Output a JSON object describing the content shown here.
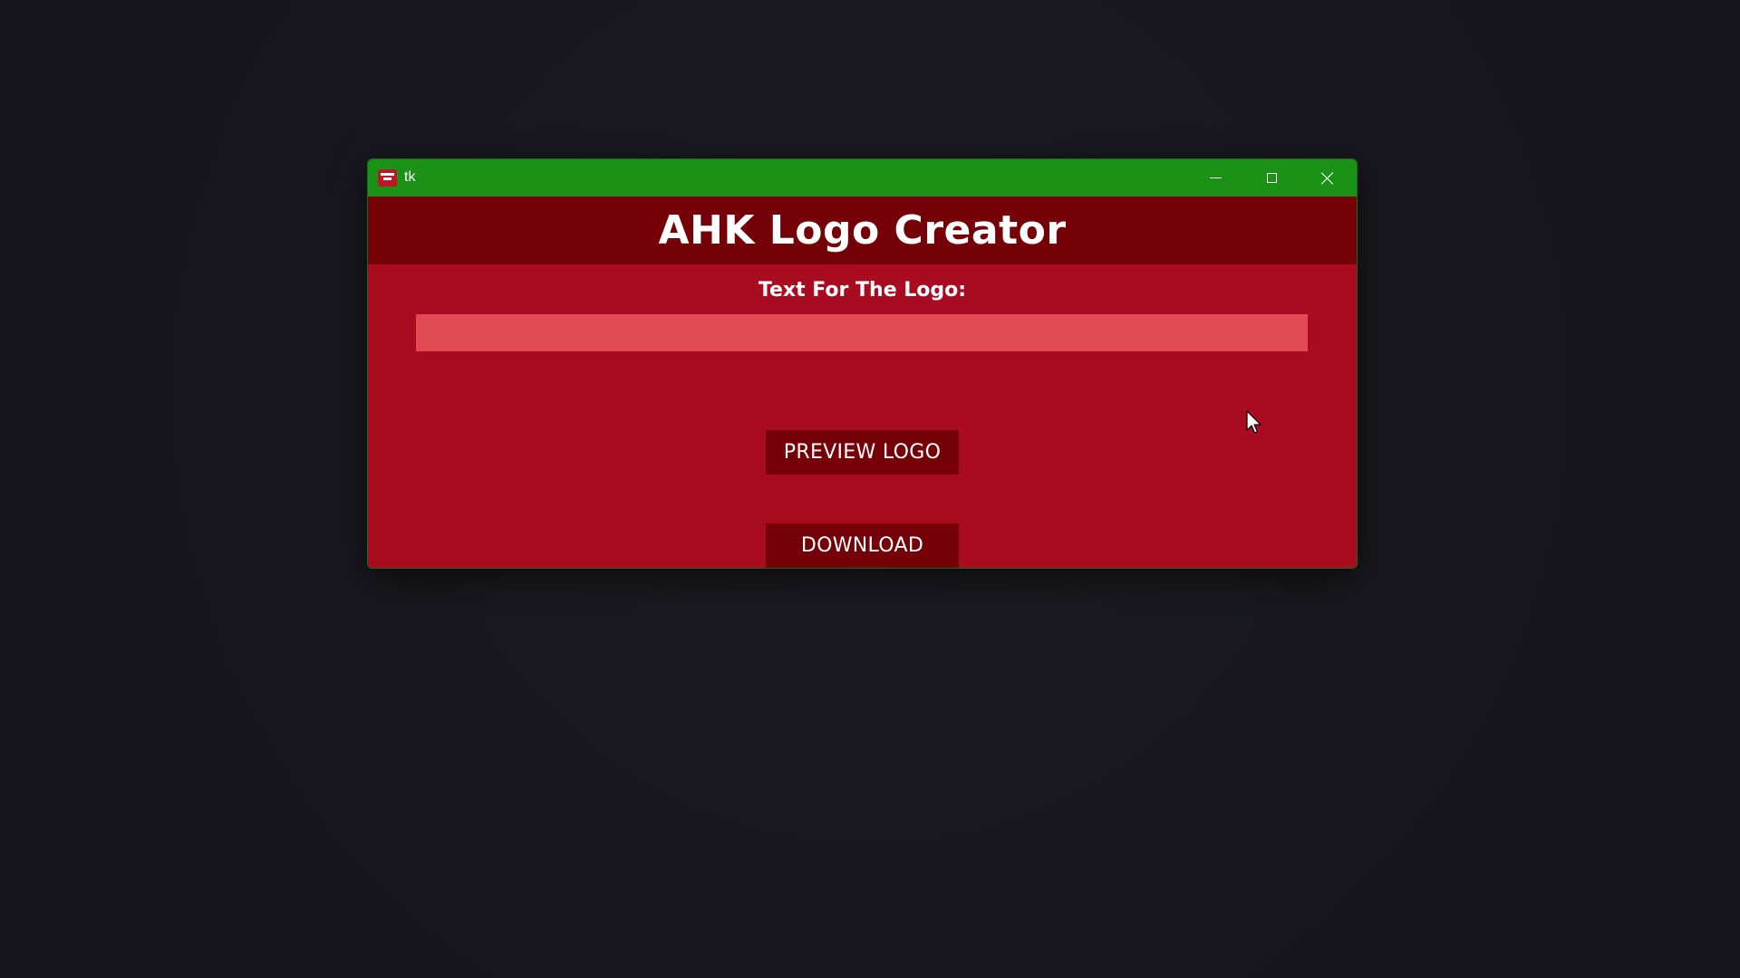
{
  "window": {
    "title": "tk",
    "icon": "app-icon",
    "controls": {
      "minimize_icon": "minimize-icon",
      "maximize_icon": "maximize-icon",
      "close_icon": "close-icon"
    }
  },
  "app": {
    "heading": "AHK Logo Creator",
    "field_label": "Text For The Logo:",
    "input_value": "",
    "preview_button": "PREVIEW LOGO",
    "download_button": "DOWNLOAD"
  },
  "colors": {
    "titlebar": "#1b9216",
    "header_band": "#760007",
    "body": "#a90b20",
    "input": "#e04a52",
    "button": "#760007",
    "desktop": "#17161e"
  }
}
